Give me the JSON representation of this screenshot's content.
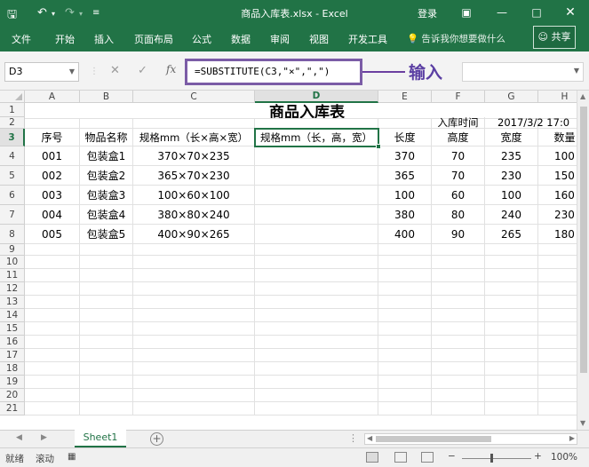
{
  "window": {
    "title": "商品入库表.xlsx  -  Excel",
    "login": "登录"
  },
  "ribbon": {
    "tabs": [
      "文件",
      "开始",
      "插入",
      "页面布局",
      "公式",
      "数据",
      "审阅",
      "视图",
      "开发工具"
    ],
    "tell_me": "告诉我你想要做什么",
    "share": "共享"
  },
  "formula_bar": {
    "name_box": "D3",
    "formula": "=SUBSTITUTE(C3,\"×\",\",\")",
    "annotation": "输入"
  },
  "columns": [
    "A",
    "B",
    "C",
    "D",
    "E",
    "F",
    "G",
    "H"
  ],
  "rows": [
    "1",
    "2",
    "3",
    "4",
    "5",
    "6",
    "7",
    "8",
    "9",
    "10",
    "11",
    "12",
    "13",
    "14",
    "15",
    "16",
    "17",
    "18",
    "19",
    "20",
    "21"
  ],
  "selected": {
    "column": "D",
    "row": "3"
  },
  "sheet": {
    "title": "商品入库表",
    "date_label": "入库时间",
    "date_value": "2017/3/2 17:0",
    "headers": [
      "序号",
      "物品名称",
      "规格mm（长×高×宽）",
      "规格mm（长，高，宽）",
      "长度",
      "高度",
      "宽度",
      "数量"
    ],
    "data": [
      [
        "001",
        "包装盒1",
        "370×70×235",
        "",
        "370",
        "70",
        "235",
        "100"
      ],
      [
        "002",
        "包装盒2",
        "365×70×230",
        "",
        "365",
        "70",
        "230",
        "150"
      ],
      [
        "003",
        "包装盒3",
        "100×60×100",
        "",
        "100",
        "60",
        "100",
        "160"
      ],
      [
        "004",
        "包装盒4",
        "380×80×240",
        "",
        "380",
        "80",
        "240",
        "230"
      ],
      [
        "005",
        "包装盒5",
        "400×90×265",
        "",
        "400",
        "90",
        "265",
        "180"
      ]
    ]
  },
  "tabs": {
    "active": "Sheet1"
  },
  "status": {
    "ready": "就绪",
    "scroll": "滚动",
    "zoom": "100%"
  }
}
